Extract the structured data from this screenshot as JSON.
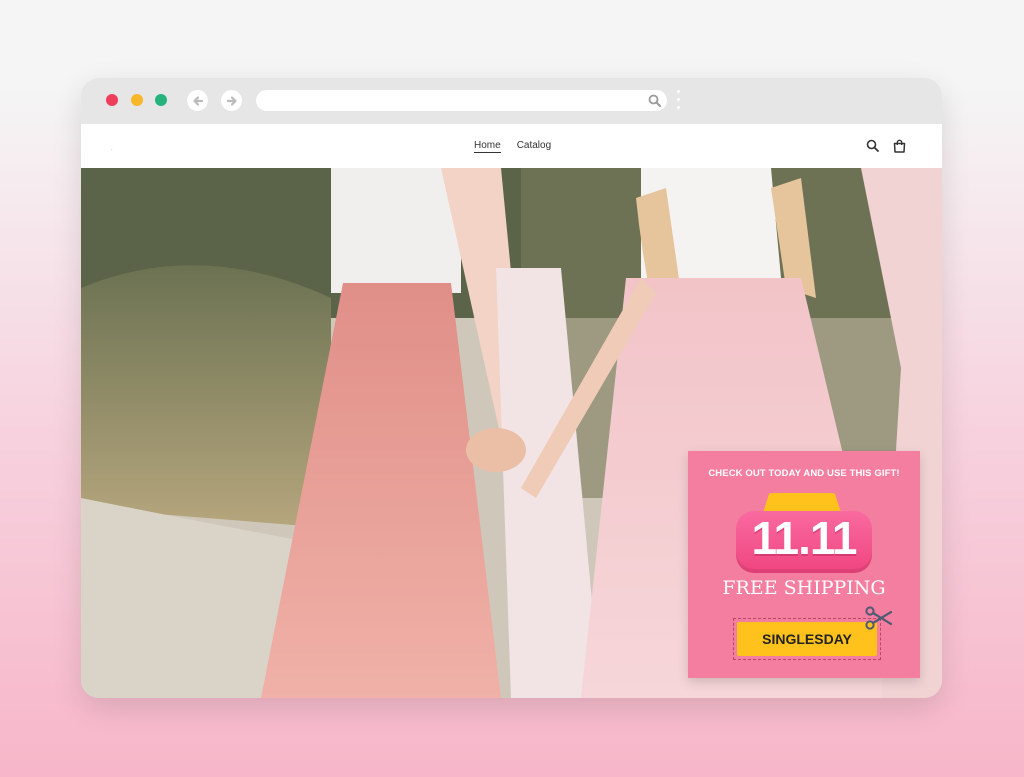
{
  "browser": {
    "buttons": [
      "close",
      "minimize",
      "maximize"
    ],
    "nav_icons": [
      "back-arrow-icon",
      "forward-arrow-icon"
    ],
    "url": "",
    "url_icon": "search-icon"
  },
  "site": {
    "brand": ".",
    "menu": [
      {
        "label": "Home",
        "active": true
      },
      {
        "label": "Catalog",
        "active": false
      }
    ],
    "header_icons": [
      "search-icon",
      "cart-icon"
    ]
  },
  "popup": {
    "headline": "CHECK OUT TODAY AND USE THIS GIFT!",
    "badge_text": "11.11",
    "offer": "FREE SHIPPING",
    "coupon_code": "SINGLESDAY",
    "colors": {
      "background": "#f47ea0",
      "badge": "#f0457f",
      "accent": "#ffc21d"
    }
  }
}
